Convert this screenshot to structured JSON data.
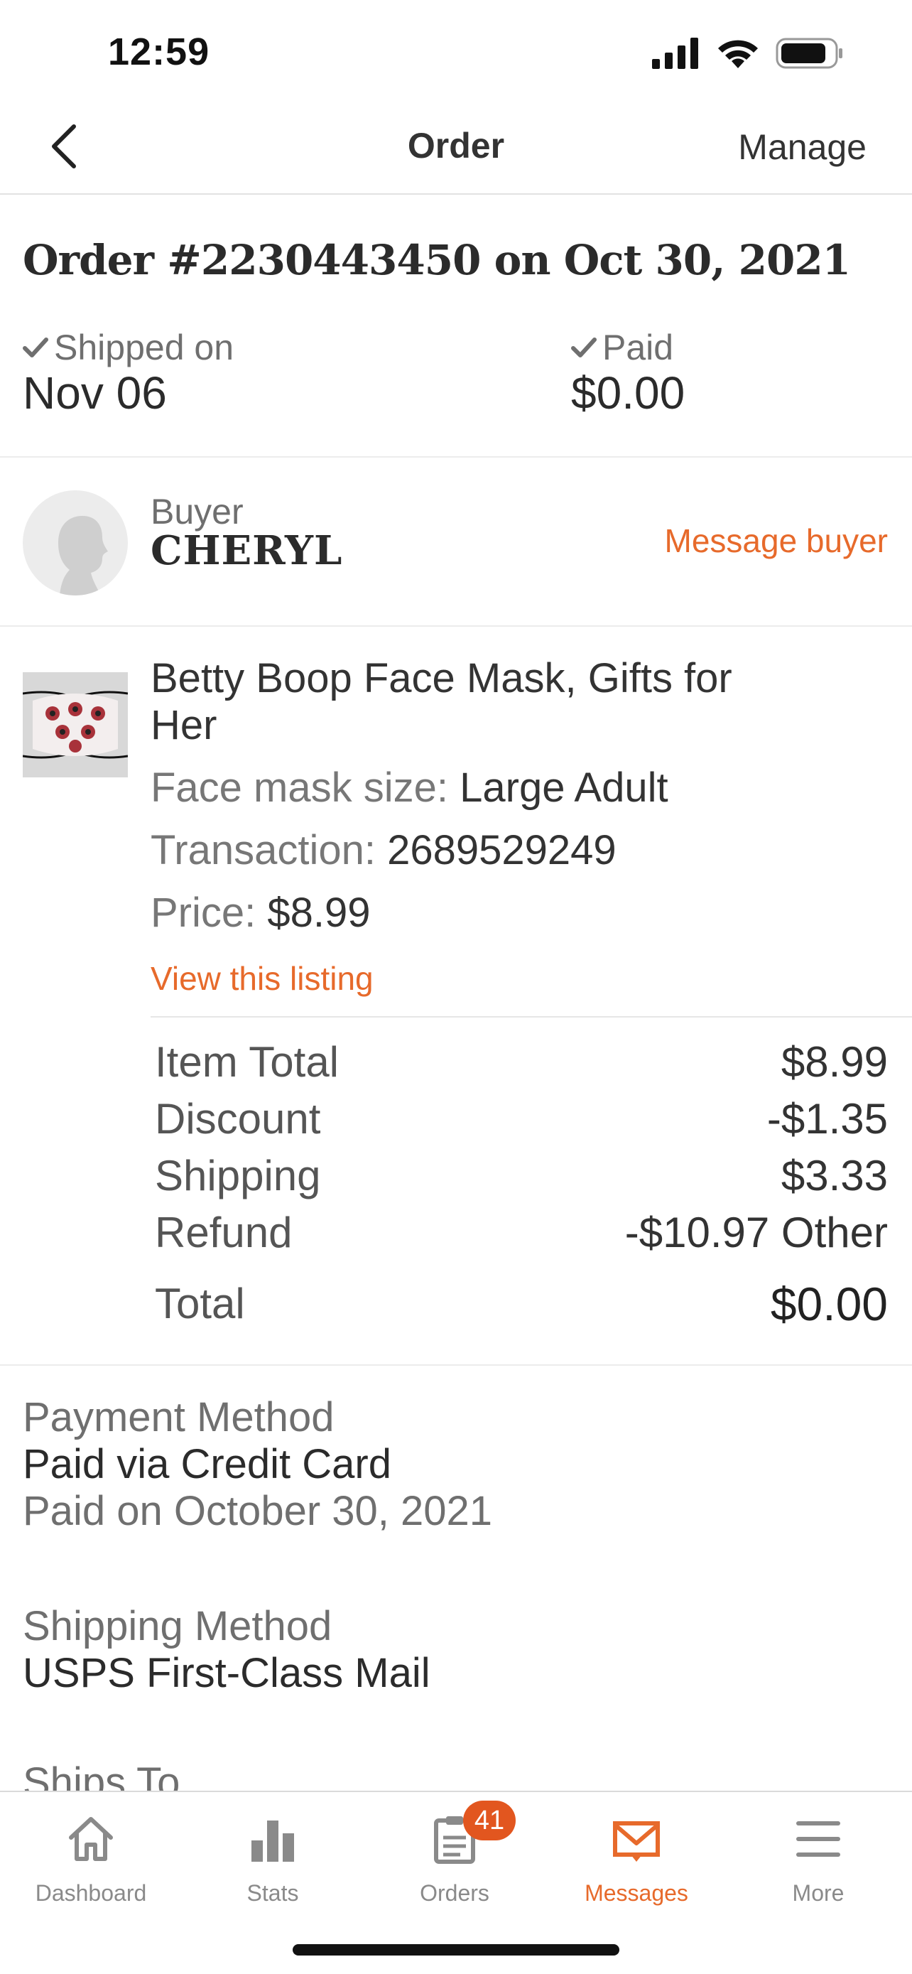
{
  "status_bar": {
    "time": "12:59"
  },
  "nav": {
    "title": "Order",
    "manage": "Manage"
  },
  "order": {
    "title": "Order #2230443450 on Oct 30, 2021",
    "shipped_label": "Shipped on",
    "shipped_value": "Nov 06",
    "paid_label": "Paid",
    "paid_value": "$0.00"
  },
  "buyer": {
    "label": "Buyer",
    "name": "CHERYL",
    "message": "Message buyer"
  },
  "item": {
    "title": "Betty Boop Face Mask, Gifts for Her",
    "size_label": "Face mask size:",
    "size_value": "Large Adult",
    "transaction_label": "Transaction:",
    "transaction_value": "2689529249",
    "price_label": "Price:",
    "price_value": "$8.99",
    "view_listing": "View this listing"
  },
  "totals": {
    "rows": [
      {
        "label": "Item Total",
        "value": "$8.99"
      },
      {
        "label": "Discount",
        "value": "-$1.35"
      },
      {
        "label": "Shipping",
        "value": "$3.33"
      },
      {
        "label": "Refund",
        "value": "-$10.97 Other"
      }
    ],
    "total_label": "Total",
    "total_value": "$0.00"
  },
  "payment": {
    "label": "Payment Method",
    "value": "Paid via Credit Card",
    "date": "Paid on October 30, 2021"
  },
  "shipping": {
    "label": "Shipping Method",
    "value": "USPS First-Class Mail",
    "ships_to_label": "Ships To"
  },
  "tabs": [
    {
      "label": "Dashboard",
      "icon": "home-icon"
    },
    {
      "label": "Stats",
      "icon": "bar-chart-icon"
    },
    {
      "label": "Orders",
      "icon": "clipboard-icon",
      "badge": "41"
    },
    {
      "label": "Messages",
      "icon": "envelope-icon"
    },
    {
      "label": "More",
      "icon": "menu-icon"
    }
  ],
  "colors": {
    "accent": "#e76a2b",
    "badge": "#e2561f"
  }
}
